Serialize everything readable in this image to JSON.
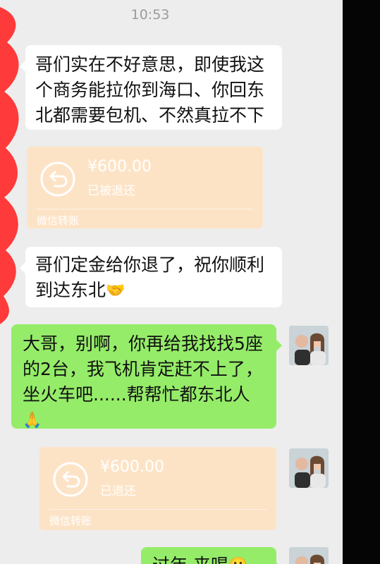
{
  "status": {
    "time": "10:53"
  },
  "messages": [
    {
      "side": "left",
      "type": "text",
      "text": "哥们实在不好意思，即使我这个商务能拉你到海口、你回东北都需要包机、不然真拉不下"
    },
    {
      "side": "left",
      "type": "transfer",
      "amount": "¥600.00",
      "status": "已被退还",
      "source": "微信转账"
    },
    {
      "side": "left",
      "type": "text",
      "text": "哥们定金给你退了，祝你顺利到达东北",
      "emoji": "handshake"
    },
    {
      "side": "right",
      "type": "text",
      "text": "大哥，别啊，你再给我找找5座的2台，我飞机肯定赶不上了，坐火车吧......帮帮忙都东北人",
      "emoji": "folded-hands"
    },
    {
      "side": "right",
      "type": "transfer",
      "amount": "¥600.00",
      "status": "已退还",
      "source": "微信转账"
    },
    {
      "side": "right",
      "type": "text",
      "text": "过年 来喝",
      "emoji": "smile"
    }
  ],
  "colors": {
    "page_bg": "#ededed",
    "bubble_left": "#ffffff",
    "bubble_right": "#95ec69",
    "transfer_bg": "#fde3c6",
    "redaction": "#ff2a2a"
  }
}
